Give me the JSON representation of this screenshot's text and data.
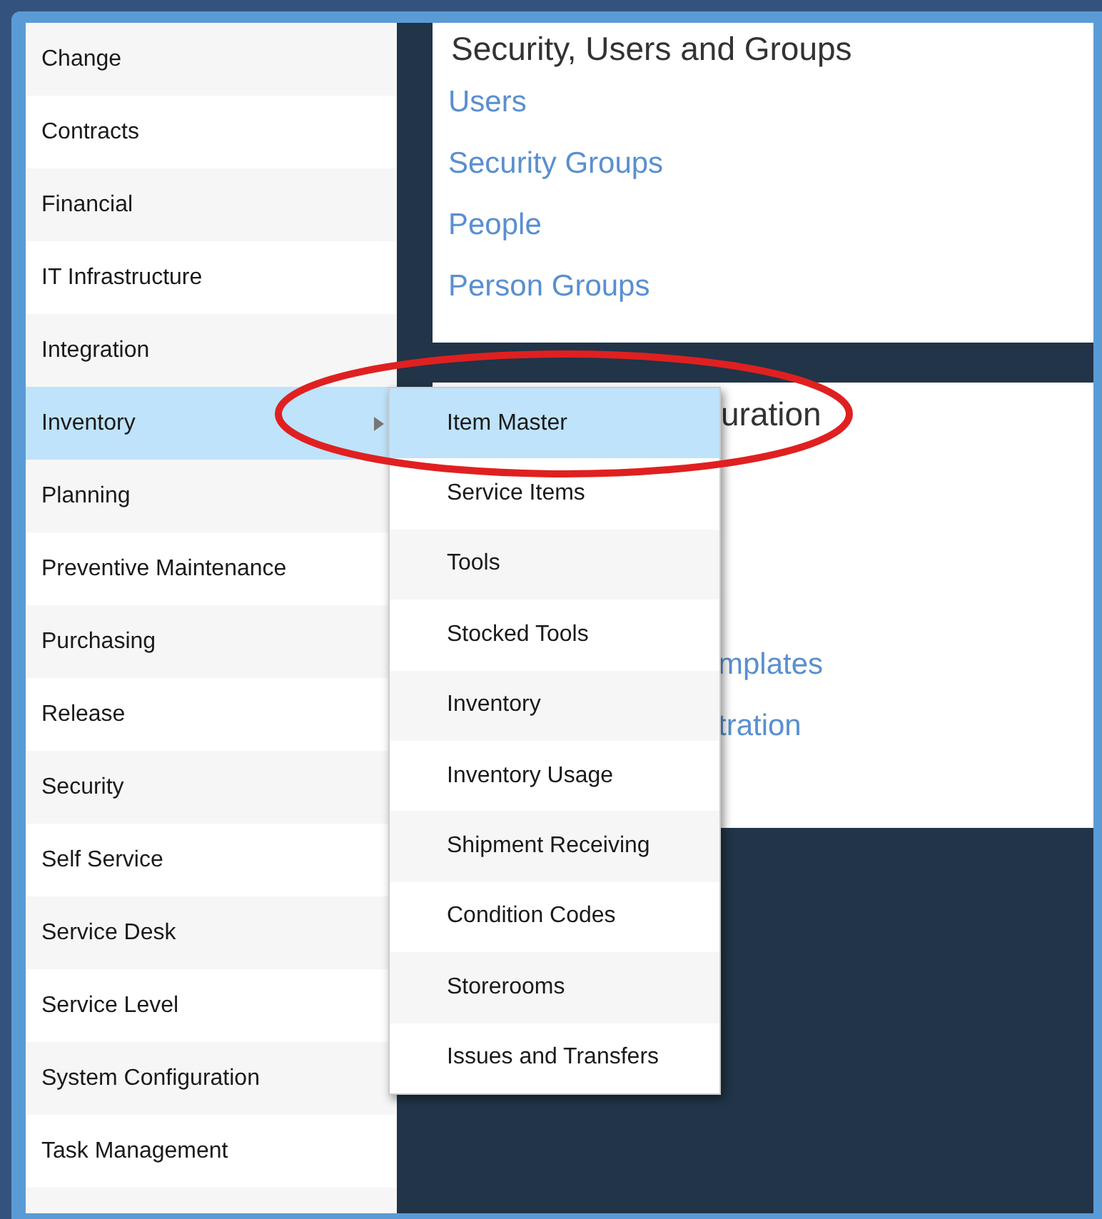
{
  "sidebar": {
    "items": [
      {
        "label": "Change",
        "selected": false
      },
      {
        "label": "Contracts",
        "selected": false
      },
      {
        "label": "Financial",
        "selected": false
      },
      {
        "label": "IT Infrastructure",
        "selected": false
      },
      {
        "label": "Integration",
        "selected": false
      },
      {
        "label": "Inventory",
        "selected": true
      },
      {
        "label": "Planning",
        "selected": false
      },
      {
        "label": "Preventive Maintenance",
        "selected": false
      },
      {
        "label": "Purchasing",
        "selected": false
      },
      {
        "label": "Release",
        "selected": false
      },
      {
        "label": "Security",
        "selected": false
      },
      {
        "label": "Self Service",
        "selected": false
      },
      {
        "label": "Service Desk",
        "selected": false
      },
      {
        "label": "Service Level",
        "selected": false
      },
      {
        "label": "System Configuration",
        "selected": false
      },
      {
        "label": "Task Management",
        "selected": false
      }
    ]
  },
  "panels": [
    {
      "kind": "full",
      "title": "Security, Users and Groups",
      "links": [
        "Users",
        "Security Groups",
        "People",
        "Person Groups"
      ]
    },
    {
      "kind": "covered",
      "title": "uration",
      "links": [
        "mplates",
        "tration"
      ]
    }
  ],
  "submenu": {
    "items": [
      {
        "label": "Item Master",
        "selected": true
      },
      {
        "label": "Service Items",
        "selected": false
      },
      {
        "label": "Tools",
        "selected": false
      },
      {
        "label": "Stocked Tools",
        "selected": false
      },
      {
        "label": "Inventory",
        "selected": false
      },
      {
        "label": "Inventory Usage",
        "selected": false
      },
      {
        "label": "Shipment Receiving",
        "selected": false
      },
      {
        "label": "Condition Codes",
        "selected": false
      },
      {
        "label": "Storerooms",
        "selected": false
      },
      {
        "label": "Issues and Transfers",
        "selected": false
      }
    ]
  }
}
